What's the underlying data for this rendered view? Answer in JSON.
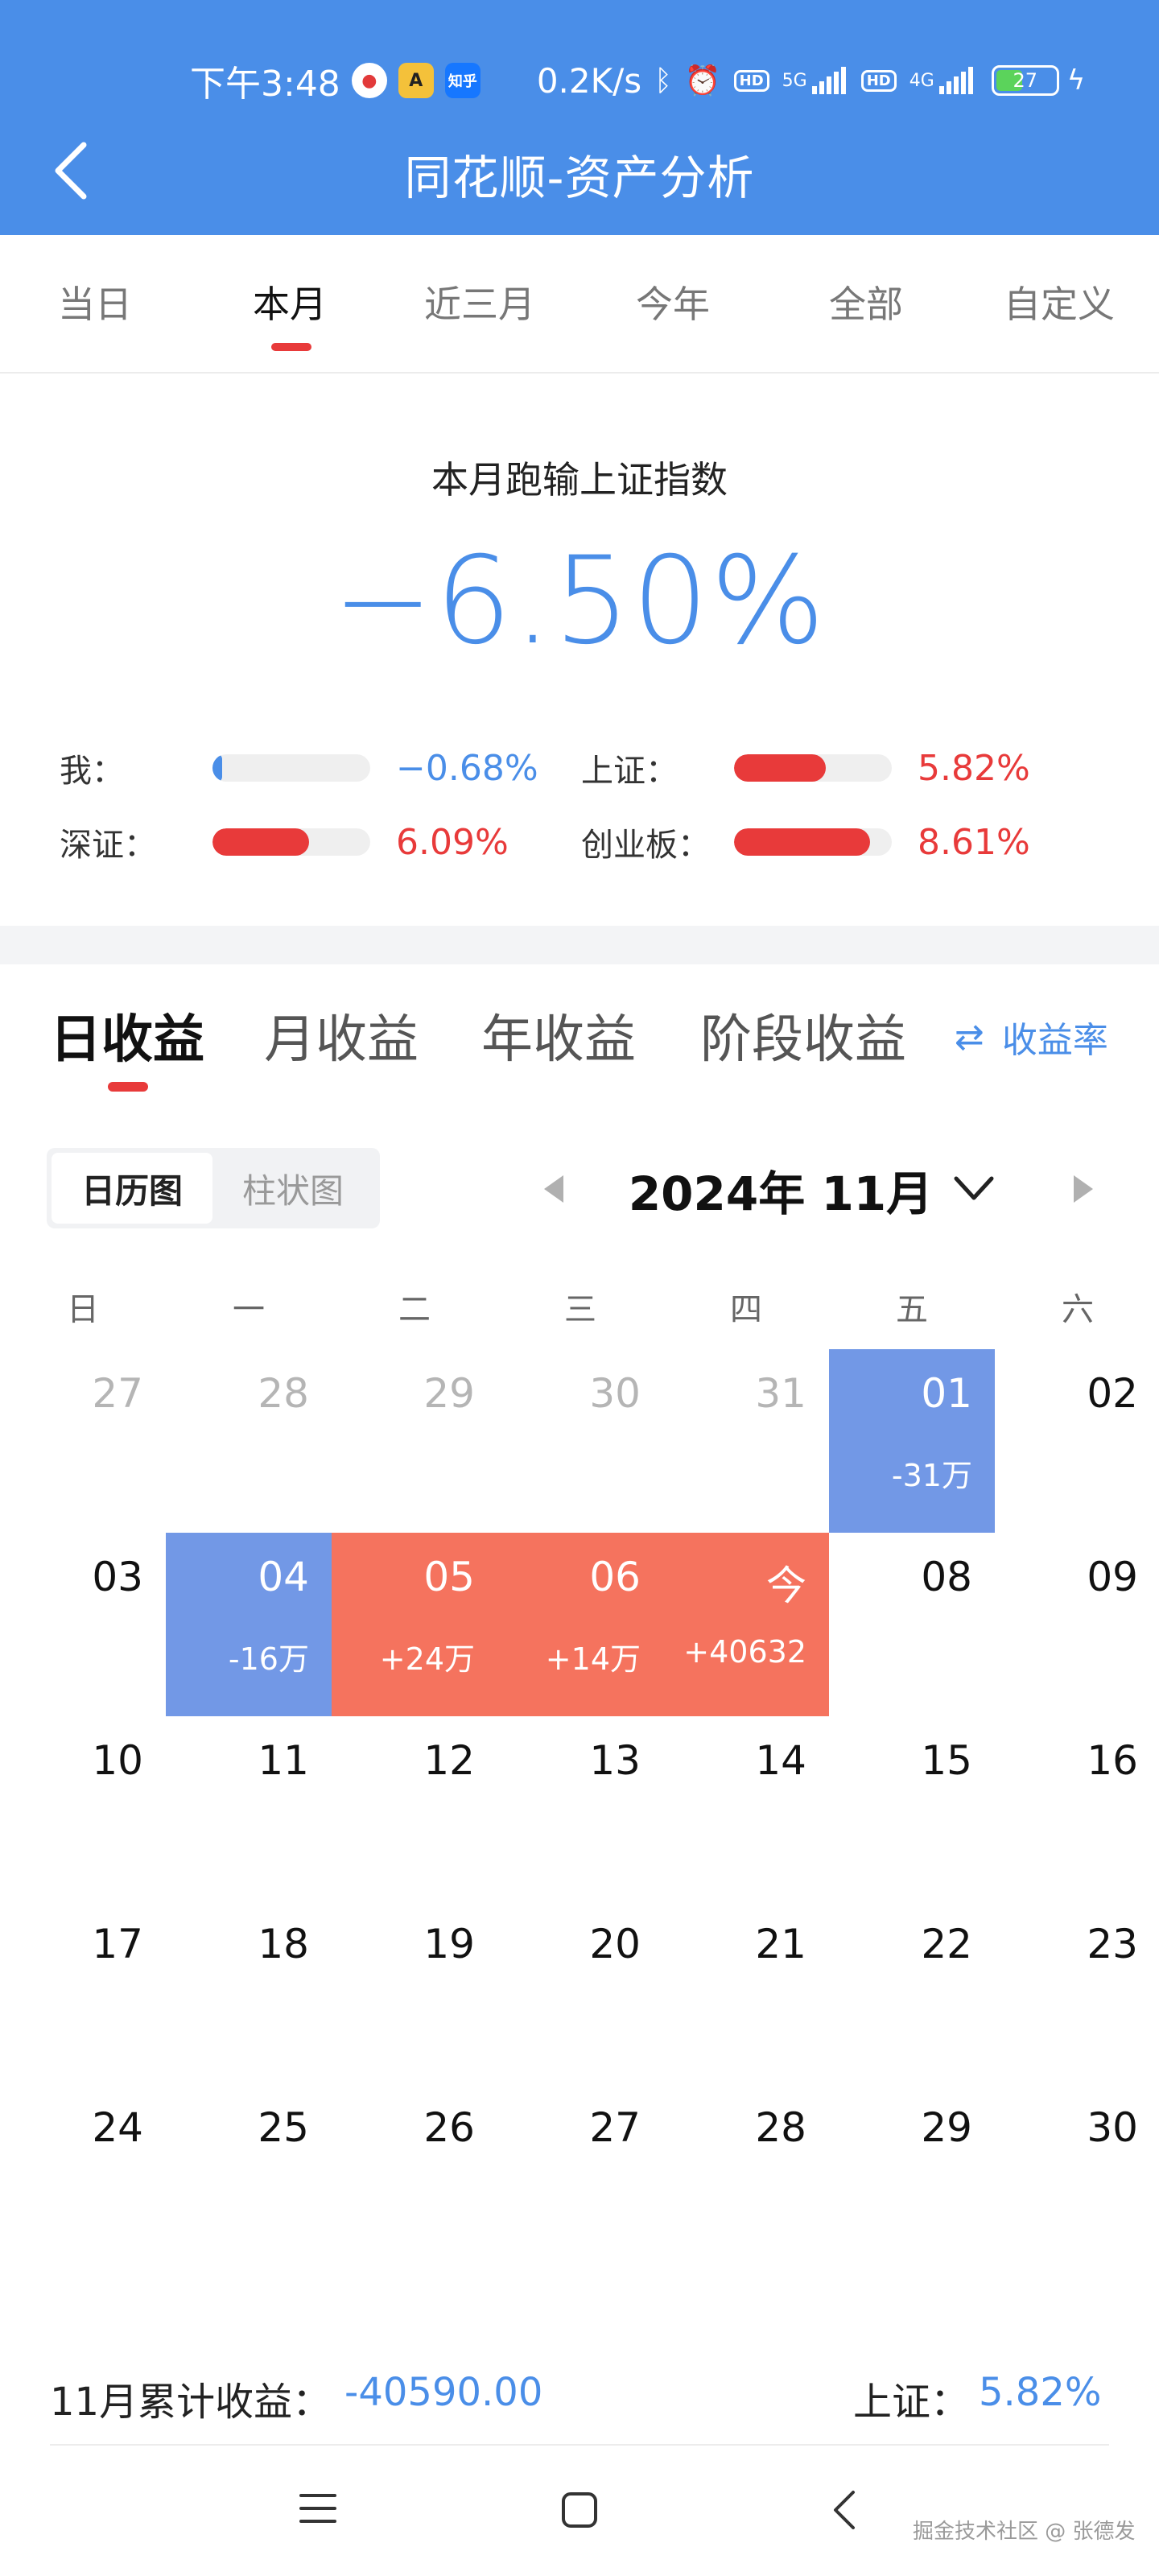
{
  "status_bar": {
    "time": "下午3:48",
    "notif_zhihu": "知乎",
    "net_speed": "0.2K/s",
    "net1": "5G",
    "net2": "4G",
    "hd": "HD",
    "battery": "27"
  },
  "header": {
    "title": "同花顺-资产分析"
  },
  "period_tabs": [
    "当日",
    "本月",
    "近三月",
    "今年",
    "全部",
    "自定义"
  ],
  "period_active": "本月",
  "summary": {
    "label": "本月跑输上证指数",
    "value": "−6.50%",
    "rows": [
      {
        "label": "我：",
        "value": "−0.68%",
        "fill": 0.06,
        "color": "#4a8ee8"
      },
      {
        "label": "上证：",
        "value": "5.82%",
        "fill": 0.58,
        "color": "#e83a3a"
      },
      {
        "label": "深证：",
        "value": "6.09%",
        "fill": 0.61,
        "color": "#e83a3a"
      },
      {
        "label": "创业板：",
        "value": "8.61%",
        "fill": 0.86,
        "color": "#e83a3a"
      }
    ]
  },
  "income_tabs": [
    "日收益",
    "月收益",
    "年收益",
    "阶段收益"
  ],
  "rate_toggle": "收益率",
  "view_toggle": [
    "日历图",
    "柱状图"
  ],
  "month": "2024年 11月",
  "weekdays": [
    "日",
    "一",
    "二",
    "三",
    "四",
    "五",
    "六"
  ],
  "calendar": [
    [
      {
        "day": "27",
        "muted": true
      },
      {
        "day": "28",
        "muted": true
      },
      {
        "day": "29",
        "muted": true
      },
      {
        "day": "30",
        "muted": true
      },
      {
        "day": "31",
        "muted": true
      },
      {
        "day": "01",
        "amount": "-31万",
        "state": "loss"
      },
      {
        "day": "02"
      }
    ],
    [
      {
        "day": "03"
      },
      {
        "day": "04",
        "amount": "-16万",
        "state": "loss"
      },
      {
        "day": "05",
        "amount": "+24万",
        "state": "gain"
      },
      {
        "day": "06",
        "amount": "+14万",
        "state": "gain"
      },
      {
        "day": "今",
        "amount": "+40632",
        "state": "gain"
      },
      {
        "day": "08"
      },
      {
        "day": "09"
      }
    ],
    [
      {
        "day": "10"
      },
      {
        "day": "11"
      },
      {
        "day": "12"
      },
      {
        "day": "13"
      },
      {
        "day": "14"
      },
      {
        "day": "15"
      },
      {
        "day": "16"
      }
    ],
    [
      {
        "day": "17"
      },
      {
        "day": "18"
      },
      {
        "day": "19"
      },
      {
        "day": "20"
      },
      {
        "day": "21"
      },
      {
        "day": "22"
      },
      {
        "day": "23"
      }
    ],
    [
      {
        "day": "24"
      },
      {
        "day": "25"
      },
      {
        "day": "26"
      },
      {
        "day": "27"
      },
      {
        "day": "28"
      },
      {
        "day": "29"
      },
      {
        "day": "30"
      }
    ]
  ],
  "footer": {
    "label": "11月累计收益：",
    "value": "-40590.00",
    "sh_label": "上证：",
    "sh_value": "5.82%"
  },
  "watermark": "掘金技术社区 @ 张德发",
  "icons": {
    "back": "chevron-left-icon",
    "swap": "swap-arrows-icon",
    "prev": "triangle-left-icon",
    "next": "triangle-right-icon",
    "dropdown": "chevron-down-icon"
  }
}
